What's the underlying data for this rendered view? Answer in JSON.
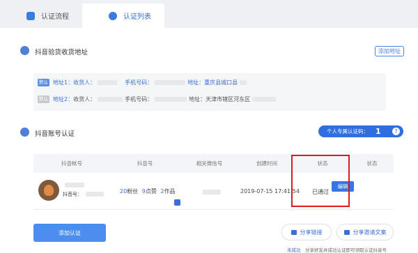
{
  "tabs": [
    {
      "label": "认证流程",
      "icon": "document-icon"
    },
    {
      "label": "认证列表",
      "icon": "verified-user-icon"
    }
  ],
  "address_section": {
    "title": "抖音验货收货地址",
    "add_button": "添加地址",
    "addresses": [
      {
        "tag": "默认",
        "tag_color": "#5b8ee6",
        "label": "地址1：",
        "receiver_label": "收货人：",
        "phone_label": "手机号码：",
        "address_label": "地址：",
        "address_value": "重庆县城口县"
      },
      {
        "tag": "默认",
        "tag_color": "#c5c8ce",
        "label": "地址2：",
        "receiver_label": "收货人：",
        "phone_label": "手机号码：",
        "address_label": "地址：",
        "address_value": "天津市辖区河东区"
      }
    ]
  },
  "account_section": {
    "title": "抖音账号认证",
    "pill_label": "个人专属认证码：",
    "pill_value": "1",
    "pill_help": "?",
    "columns": [
      "抖音帐号",
      "抖音号",
      "相关微信号",
      "创建时间",
      "状态",
      "状态"
    ],
    "row": {
      "account_label": "抖音号：",
      "fans": "20",
      "fans_label": "粉丝",
      "likes": "9",
      "likes_label": "点赞",
      "works": "2",
      "works_label": "作品",
      "created": "2019-07-15 17:41:54",
      "status": "已通过",
      "edit": "编辑"
    }
  },
  "footer": {
    "add_button": "添加认证",
    "share_link": "分享链接",
    "share_invite": "分享邀请文案",
    "note_success": "未成功",
    "note": "分享好友并成功认证即可领取认证抖音号"
  }
}
